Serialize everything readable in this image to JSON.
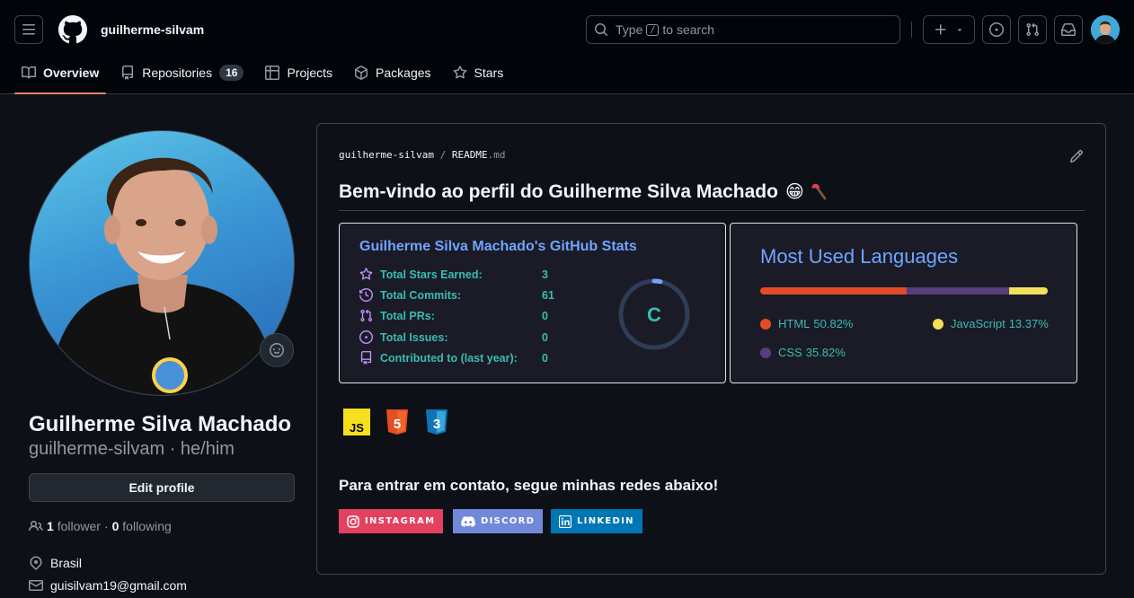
{
  "header": {
    "username": "guilherme-silvam",
    "search": {
      "prefix": "Type",
      "key": "/",
      "suffix": "to search"
    }
  },
  "tabs": [
    {
      "label": "Overview",
      "icon": "book-icon",
      "active": true
    },
    {
      "label": "Repositories",
      "icon": "repo-icon",
      "count": "16"
    },
    {
      "label": "Projects",
      "icon": "table-icon"
    },
    {
      "label": "Packages",
      "icon": "package-icon"
    },
    {
      "label": "Stars",
      "icon": "star-icon"
    }
  ],
  "profile": {
    "name": "Guilherme Silva Machado",
    "login": "guilherme-silvam",
    "pronouns": "he/him",
    "login_line": "guilherme-silvam · he/him",
    "edit_label": "Edit profile",
    "followers": "1",
    "followers_label": "follower",
    "following": "0",
    "following_label": "following",
    "location": "Brasil",
    "email": "guisilvam19@gmail.com"
  },
  "readme": {
    "crumb_user": "guilherme-silvam",
    "crumb_sep": "/",
    "crumb_file": "README",
    "crumb_ext": ".md",
    "title": "Bem-vindo ao perfil do Guilherme Silva Machado",
    "title_emoji": "😁",
    "stats": {
      "title": "Guilherme Silva Machado's GitHub Stats",
      "rows": [
        {
          "label": "Total Stars Earned:",
          "value": "3",
          "icon": "star-icon"
        },
        {
          "label": "Total Commits:",
          "value": "61",
          "icon": "history-icon"
        },
        {
          "label": "Total PRs:",
          "value": "0",
          "icon": "pull-request-icon"
        },
        {
          "label": "Total Issues:",
          "value": "0",
          "icon": "issue-icon"
        },
        {
          "label": "Contributed to (last year):",
          "value": "0",
          "icon": "repo-icon"
        }
      ],
      "rank": "C",
      "rank_progress": 0.03
    },
    "languages": {
      "title": "Most Used Languages",
      "items": [
        {
          "name": "HTML",
          "percent": "50.82%",
          "value": 50.82,
          "color": "#e34c26"
        },
        {
          "name": "CSS",
          "percent": "35.82%",
          "value": 35.82,
          "color": "#563d7c"
        },
        {
          "name": "JavaScript",
          "percent": "13.37%",
          "value": 13.37,
          "color": "#f1e05a"
        }
      ]
    },
    "tech_icons": [
      "javascript-icon",
      "html5-icon",
      "css3-icon"
    ],
    "contact_text": "Para entrar em contato, segue minhas redes abaixo!",
    "badges": [
      {
        "label": "INSTAGRAM",
        "color": "#e4405f",
        "icon": "instagram-icon"
      },
      {
        "label": "DISCORD",
        "color": "#7289da",
        "icon": "discord-icon"
      },
      {
        "label": "LINKEDIN",
        "color": "#0077b5",
        "icon": "linkedin-icon"
      }
    ]
  }
}
